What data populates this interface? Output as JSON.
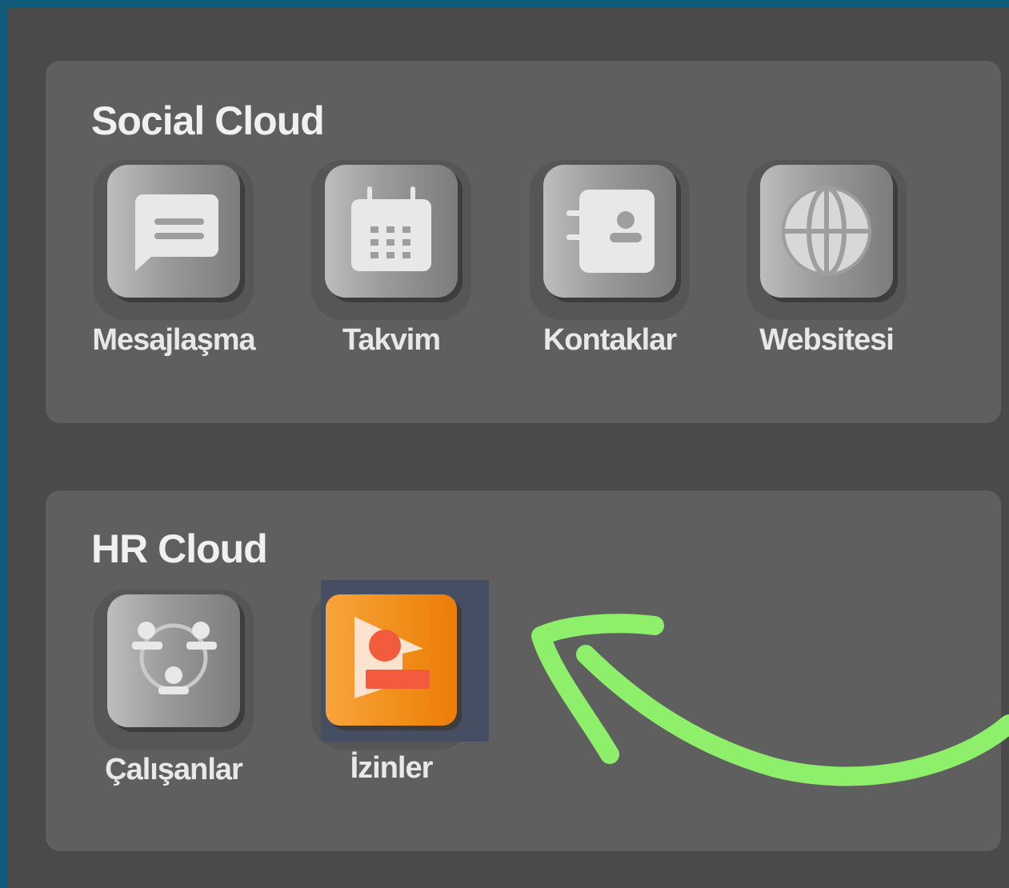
{
  "sections": {
    "social": {
      "title": "Social Cloud",
      "apps": [
        {
          "label": "Mesajlaşma",
          "icon": "message-icon"
        },
        {
          "label": "Takvim",
          "icon": "calendar-icon"
        },
        {
          "label": "Kontaklar",
          "icon": "contacts-icon"
        },
        {
          "label": "Websitesi",
          "icon": "globe-icon"
        }
      ]
    },
    "hr": {
      "title": "HR Cloud",
      "apps": [
        {
          "label": "Çalışanlar",
          "icon": "org-chart-icon"
        },
        {
          "label": "İzinler",
          "icon": "leave-icon"
        }
      ]
    }
  },
  "annotation": {
    "type": "hand-drawn-arrow",
    "color": "#8ef06a",
    "points_to": "İzinler"
  },
  "colors": {
    "background": "#105a7c",
    "frame": "#4a4a4a",
    "panel": "#5f5f5f",
    "accent": "#f08d18"
  }
}
